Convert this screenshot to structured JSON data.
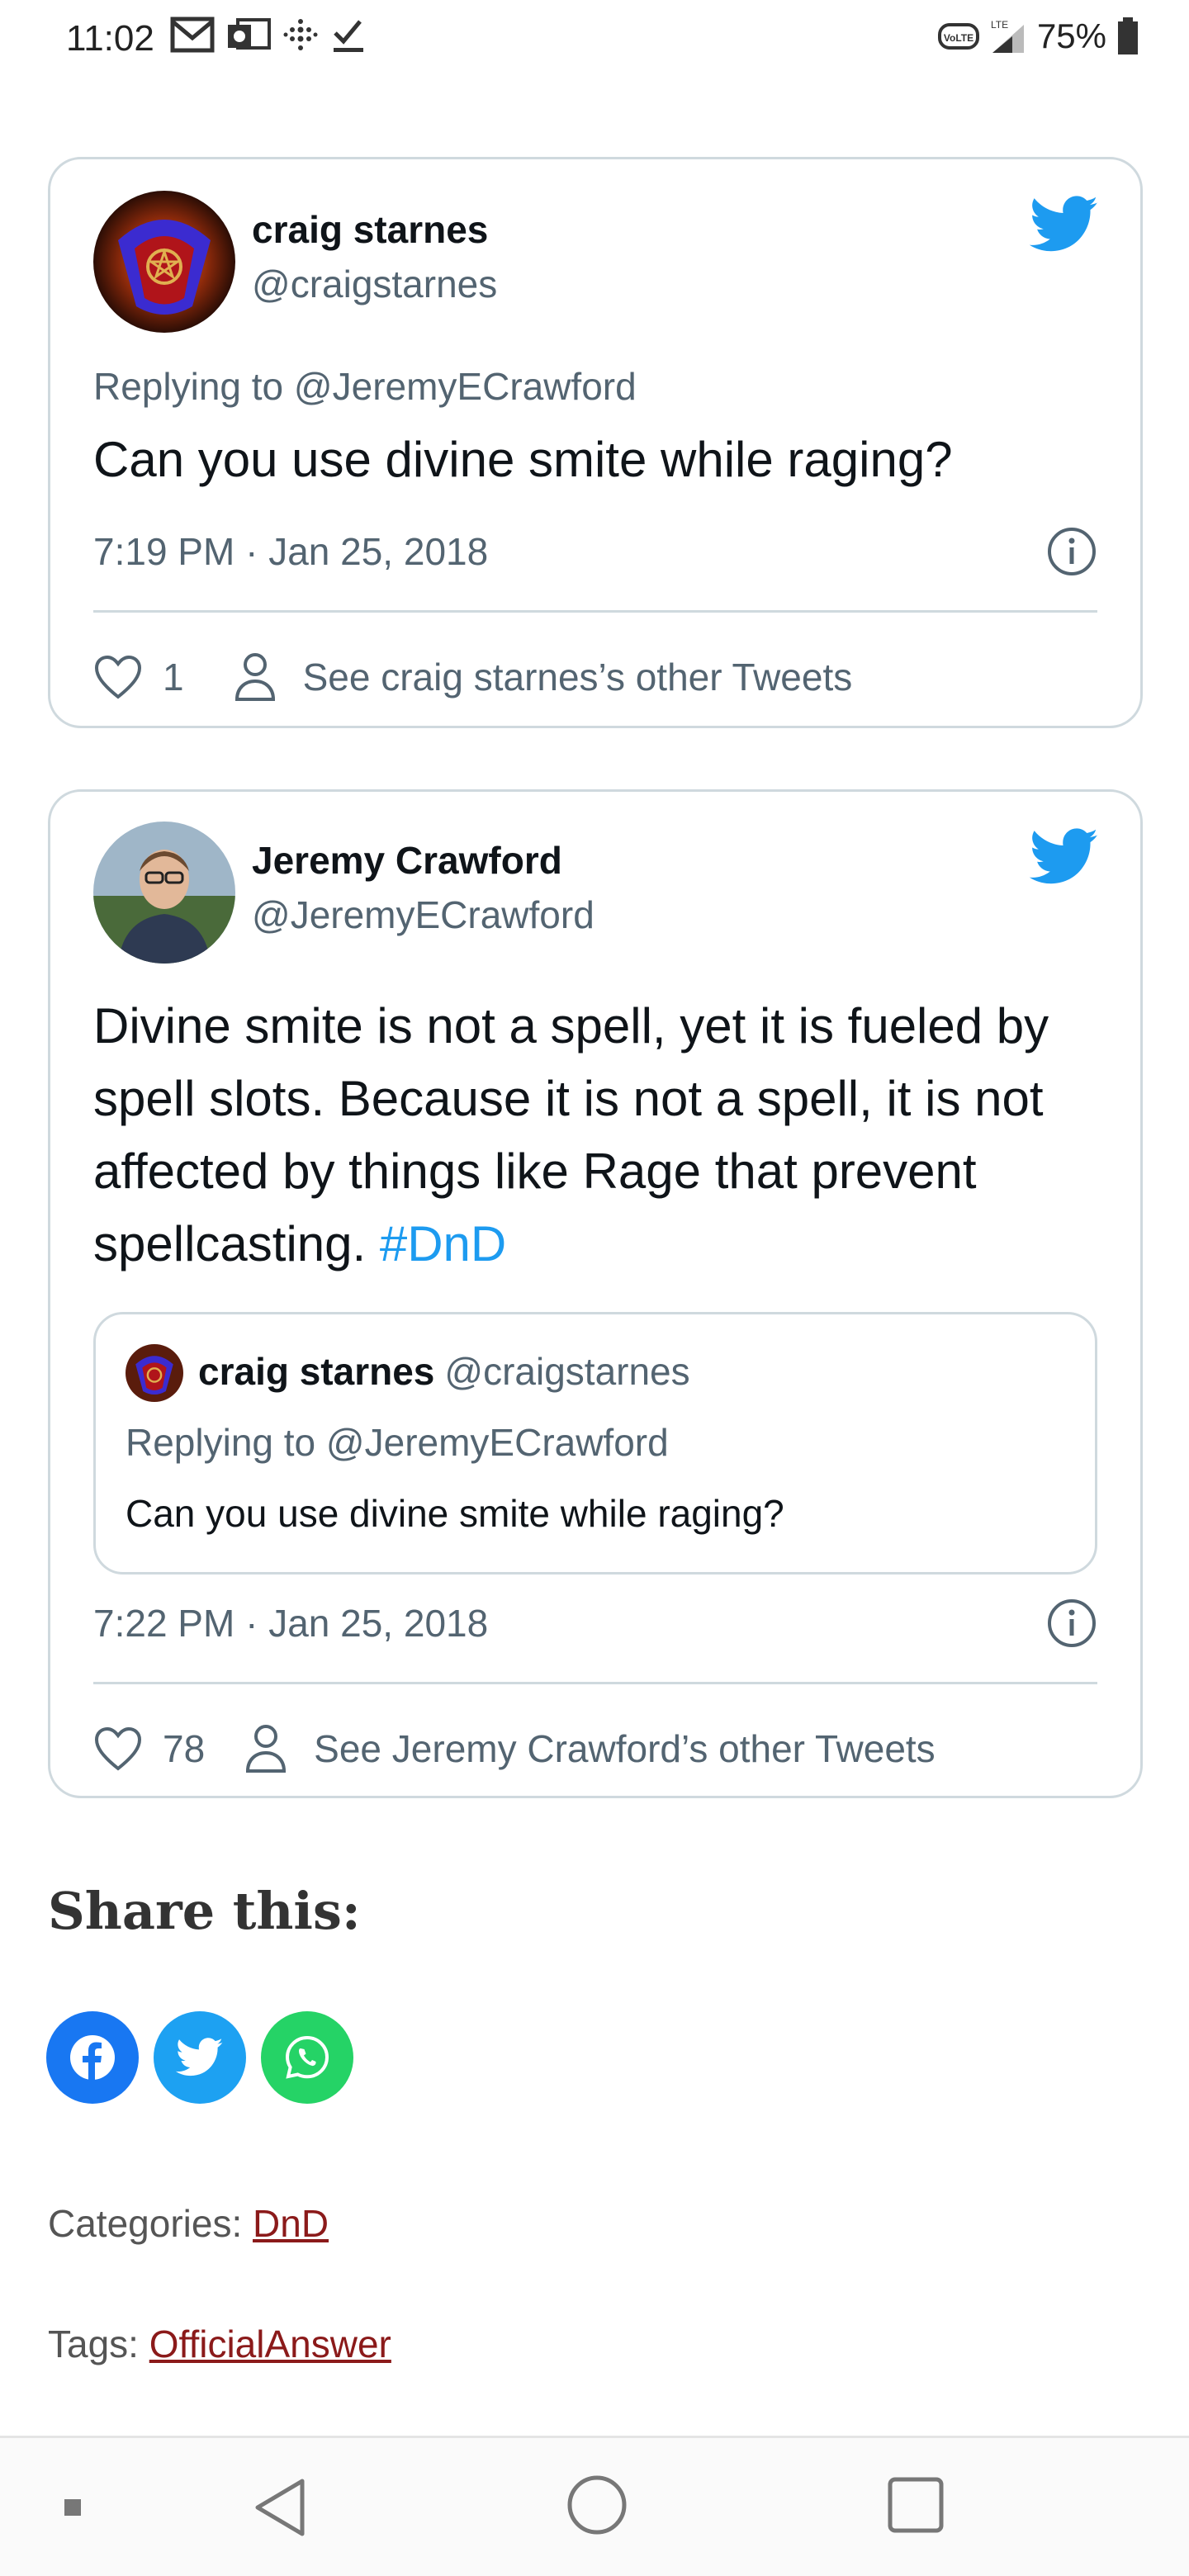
{
  "status_bar": {
    "time": "11:02",
    "battery": "75%",
    "network": "LTE",
    "volte": "VoLTE"
  },
  "tweets": [
    {
      "name": "craig starnes",
      "handle": "@craigstarnes",
      "replying_to": "Replying to @JeremyECrawford",
      "text": "Can you use divine smite while raging?",
      "timestamp": "7:19 PM · Jan 25, 2018",
      "likes": "1",
      "other_tweets": "See craig starnes’s other Tweets"
    },
    {
      "name": "Jeremy Crawford",
      "handle": "@JeremyECrawford",
      "text": "Divine smite is not a spell, yet it is fueled by spell slots. Because it is not a spell, it is not affected by things like Rage that prevent spellcasting.",
      "hashtag": "#DnD",
      "quote": {
        "name": "craig starnes",
        "handle": "@craigstarnes",
        "replying_to": "Replying to @JeremyECrawford",
        "text": "Can you use divine smite while raging?"
      },
      "timestamp": "7:22 PM · Jan 25, 2018",
      "likes": "78",
      "other_tweets": "See Jeremy Crawford’s other Tweets"
    }
  ],
  "share": {
    "title": "Share this:",
    "buttons": [
      "facebook-icon",
      "twitter-icon",
      "whatsapp-icon"
    ]
  },
  "categories": {
    "label": "Categories:",
    "value": "DnD"
  },
  "tags": {
    "label": "Tags:",
    "value": "OfficialAnswer"
  },
  "colors": {
    "twitter_blue": "#1d9bf0",
    "facebook_blue": "#1877f2",
    "whatsapp_green": "#25d366",
    "link_red": "#8b1a1a"
  }
}
